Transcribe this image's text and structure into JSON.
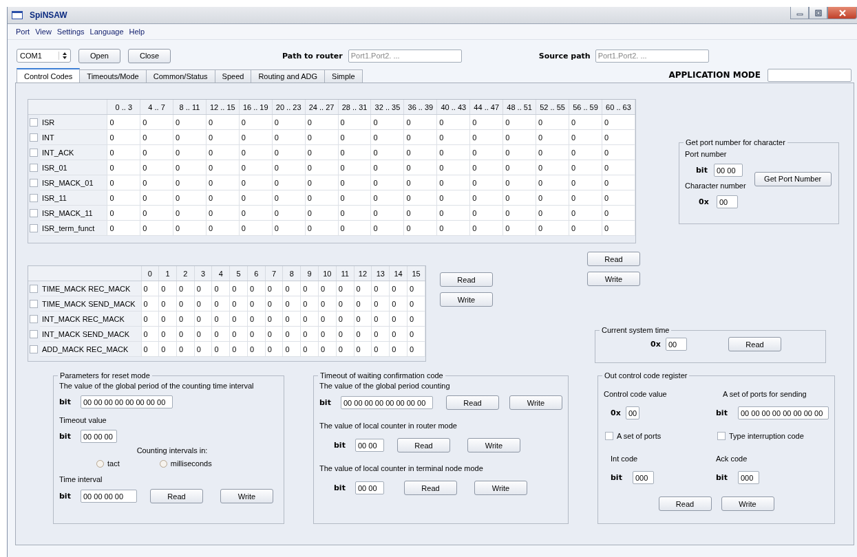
{
  "window": {
    "title": "SpiNSAW"
  },
  "menu": [
    "Port",
    "View",
    "Settings",
    "Language",
    "Help"
  ],
  "toolbar": {
    "port": "COM1",
    "buttons": [
      "Open",
      "Close"
    ],
    "path_to_router": {
      "label": "Path to router",
      "placeholder": "Port1.Port2. ..."
    },
    "source_path": {
      "label": "Source path",
      "placeholder": "Port1.Port2. ..."
    }
  },
  "tabs": [
    {
      "label": "Control Codes",
      "selected": true
    },
    {
      "label": "Timeouts/Mode",
      "selected": false
    },
    {
      "label": "Common/Status",
      "selected": false
    },
    {
      "label": "Speed",
      "selected": false
    },
    {
      "label": "Routing and ADG",
      "selected": false
    },
    {
      "label": "Simple",
      "selected": false
    }
  ],
  "application_mode": {
    "label": "APPLICATION MODE"
  },
  "control_codes_table": {
    "columns": [
      "0 .. 3",
      "4 .. 7",
      "8 .. 11",
      "12 .. 15",
      "16 .. 19",
      "20 .. 23",
      "24 .. 27",
      "28 .. 31",
      "32 .. 35",
      "36 .. 39",
      "40 .. 43",
      "44 .. 47",
      "48 .. 51",
      "52 .. 55",
      "56 .. 59",
      "60 .. 63"
    ],
    "rows": [
      {
        "label": "ISR",
        "checked": false,
        "cells": [
          "0",
          "0",
          "0",
          "0",
          "0",
          "0",
          "0",
          "0",
          "0",
          "0",
          "0",
          "0",
          "0",
          "0",
          "0",
          "0"
        ]
      },
      {
        "label": "INT",
        "checked": false,
        "cells": [
          "0",
          "0",
          "0",
          "0",
          "0",
          "0",
          "0",
          "0",
          "0",
          "0",
          "0",
          "0",
          "0",
          "0",
          "0",
          "0"
        ]
      },
      {
        "label": "INT_ACK",
        "checked": false,
        "cells": [
          "0",
          "0",
          "0",
          "0",
          "0",
          "0",
          "0",
          "0",
          "0",
          "0",
          "0",
          "0",
          "0",
          "0",
          "0",
          "0"
        ]
      },
      {
        "label": "ISR_01",
        "checked": false,
        "cells": [
          "0",
          "0",
          "0",
          "0",
          "0",
          "0",
          "0",
          "0",
          "0",
          "0",
          "0",
          "0",
          "0",
          "0",
          "0",
          "0"
        ]
      },
      {
        "label": "ISR_MACK_01",
        "checked": false,
        "cells": [
          "0",
          "0",
          "0",
          "0",
          "0",
          "0",
          "0",
          "0",
          "0",
          "0",
          "0",
          "0",
          "0",
          "0",
          "0",
          "0"
        ]
      },
      {
        "label": "ISR_11",
        "checked": false,
        "cells": [
          "0",
          "0",
          "0",
          "0",
          "0",
          "0",
          "0",
          "0",
          "0",
          "0",
          "0",
          "0",
          "0",
          "0",
          "0",
          "0"
        ]
      },
      {
        "label": "ISR_MACK_11",
        "checked": false,
        "cells": [
          "0",
          "0",
          "0",
          "0",
          "0",
          "0",
          "0",
          "0",
          "0",
          "0",
          "0",
          "0",
          "0",
          "0",
          "0",
          "0"
        ]
      },
      {
        "label": "ISR_term_funct",
        "checked": false,
        "cells": [
          "0",
          "0",
          "0",
          "0",
          "0",
          "0",
          "0",
          "0",
          "0",
          "0",
          "0",
          "0",
          "0",
          "0",
          "0",
          "0"
        ]
      }
    ]
  },
  "control_codes_buttons": [
    "Read",
    "Write"
  ],
  "mack_table": {
    "columns": [
      "0",
      "1",
      "2",
      "3",
      "4",
      "5",
      "6",
      "7",
      "8",
      "9",
      "10",
      "11",
      "12",
      "13",
      "14",
      "15"
    ],
    "rows": [
      {
        "label": "TIME_MACK REC_MACK",
        "checked": false,
        "cells": [
          "0",
          "0",
          "0",
          "0",
          "0",
          "0",
          "0",
          "0",
          "0",
          "0",
          "0",
          "0",
          "0",
          "0",
          "0",
          "0"
        ]
      },
      {
        "label": "TIME_MACK SEND_MACK",
        "checked": false,
        "cells": [
          "0",
          "0",
          "0",
          "0",
          "0",
          "0",
          "0",
          "0",
          "0",
          "0",
          "0",
          "0",
          "0",
          "0",
          "0",
          "0"
        ]
      },
      {
        "label": "INT_MACK REC_MACK",
        "checked": false,
        "cells": [
          "0",
          "0",
          "0",
          "0",
          "0",
          "0",
          "0",
          "0",
          "0",
          "0",
          "0",
          "0",
          "0",
          "0",
          "0",
          "0"
        ]
      },
      {
        "label": "INT_MACK SEND_MACK",
        "checked": false,
        "cells": [
          "0",
          "0",
          "0",
          "0",
          "0",
          "0",
          "0",
          "0",
          "0",
          "0",
          "0",
          "0",
          "0",
          "0",
          "0",
          "0"
        ]
      },
      {
        "label": "ADD_MACK REC_MACK",
        "checked": false,
        "cells": [
          "0",
          "0",
          "0",
          "0",
          "0",
          "0",
          "0",
          "0",
          "0",
          "0",
          "0",
          "0",
          "0",
          "0",
          "0",
          "0"
        ]
      }
    ]
  },
  "mack_buttons": [
    "Read",
    "Write"
  ],
  "get_port_number": {
    "title": "Get port number for character",
    "port_number": {
      "label": "Port number",
      "unit": "bit",
      "value": "00 00"
    },
    "character_number": {
      "label": "Character number",
      "unit": "0x",
      "value": "00"
    },
    "button": "Get Port Number"
  },
  "current_system_time": {
    "title": "Current system time",
    "unit": "0x",
    "value": "00",
    "button": "Read"
  },
  "reset_mode": {
    "title": "Parameters for reset mode",
    "global_period": {
      "label": "The value of the global period of the counting time interval",
      "unit": "bit",
      "value": "00 00 00 00 00 00 00 00"
    },
    "timeout": {
      "label": "Timeout value",
      "unit": "bit",
      "value": "00 00 00"
    },
    "counting_intervals": {
      "label": "Counting intervals in:",
      "options": [
        {
          "label": "tact",
          "selected": false
        },
        {
          "label": "milliseconds",
          "selected": false
        }
      ]
    },
    "time_interval": {
      "label": "Time interval",
      "unit": "bit",
      "value": "00 00 00 00"
    },
    "buttons": [
      "Read",
      "Write"
    ]
  },
  "timeout_confirmation": {
    "title": "Timeout of waiting confirmation code",
    "fields": [
      {
        "label": "The value of the global period counting",
        "unit": "bit",
        "value": "00 00 00 00 00 00 00 00",
        "buttons": [
          "Read",
          "Write"
        ]
      },
      {
        "label": "The value of local counter in router mode",
        "unit": "bit",
        "value": "00 00",
        "buttons": [
          "Read",
          "Write"
        ]
      },
      {
        "label": "The value of local counter in terminal node mode",
        "unit": "bit",
        "value": "00 00",
        "buttons": [
          "Read",
          "Write"
        ]
      }
    ]
  },
  "out_control_code": {
    "title": "Out control code register",
    "control_code_value": {
      "label": "Control code value",
      "unit": "0x",
      "value": "00"
    },
    "ports_for_sending": {
      "label": "A set of ports for sending",
      "unit": "bit",
      "value": "00 00 00 00 00 00 00 00"
    },
    "checkboxes": [
      {
        "label": "A set of ports",
        "checked": false
      },
      {
        "label": "Type interruption code",
        "checked": false
      }
    ],
    "int_code": {
      "label": "Int code",
      "unit": "bit",
      "value": "000"
    },
    "ack_code": {
      "label": "Ack code",
      "unit": "bit",
      "value": "000"
    },
    "buttons": [
      "Read",
      "Write"
    ]
  }
}
